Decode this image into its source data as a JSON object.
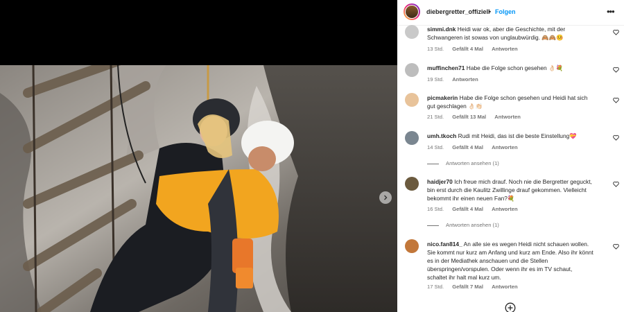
{
  "post": {
    "username": "diebergretter_offiziell",
    "separator": "•",
    "follow_label": "Folgen",
    "more_label": "•••"
  },
  "media": {
    "description_icon": "mountain-rescue-photo",
    "next_icon": "chevron-right-icon"
  },
  "comments": [
    {
      "user": "simmi.dnk",
      "text": "Heidi war ok, aber die Geschichte, mit der Schwangeren ist sowas von unglaubwürdig. 🙈🙈🤒",
      "time": "13 Std.",
      "likes": "Gefällt 4 Mal",
      "reply": "Antworten",
      "avatar_color": "#c9c9c9"
    },
    {
      "user": "muffinchen71",
      "text": "Habe die Folge schon gesehen 👌🏻💐",
      "time": "19 Std.",
      "likes": "",
      "reply": "Antworten",
      "avatar_color": "#bdbdbd"
    },
    {
      "user": "picmakerin",
      "text": "Habe die Folge schon gesehen und Heidi hat sich gut geschlagen 👌🏻👏🏻",
      "time": "21 Std.",
      "likes": "Gefällt 13 Mal",
      "reply": "Antworten",
      "avatar_color": "#e8c39a"
    },
    {
      "user": "umh.tkoch",
      "text": "Rudi mit Heidi, das ist die beste Einstellung💝",
      "time": "14 Std.",
      "likes": "Gefällt 4 Mal",
      "reply": "Antworten",
      "avatar_color": "#7a8690",
      "replies_label": "Antworten ansehen (1)"
    },
    {
      "user": "haidjer70",
      "text": "Ich freue mich drauf. Noch nie die Bergretter geguckt, bin erst durch die Kaulitz Zwillinge drauf gekommen. Vielleicht bekommt ihr einen neuen Fan?💐",
      "time": "16 Std.",
      "likes": "Gefällt 4 Mal",
      "reply": "Antworten",
      "avatar_color": "#6b5a3e",
      "replies_label": "Antworten ansehen (1)"
    },
    {
      "user": "nico.fan814_",
      "text": "An alle sie es wegen Heidi nicht schauen wollen. Sie kommt nur kurz am Anfang und kurz am Ende. Also ihr könnt es in der Mediathek anschauen und die Stellen überspringen/vorspulen. Oder wenn ihr es im TV schaut, schaltet ihr halt mal kurz um.",
      "time": "17 Std.",
      "likes": "Gefällt 7 Mal",
      "reply": "Antworten",
      "avatar_color": "#c2773a"
    }
  ],
  "footer": {
    "add_icon": "plus-circle-icon"
  }
}
